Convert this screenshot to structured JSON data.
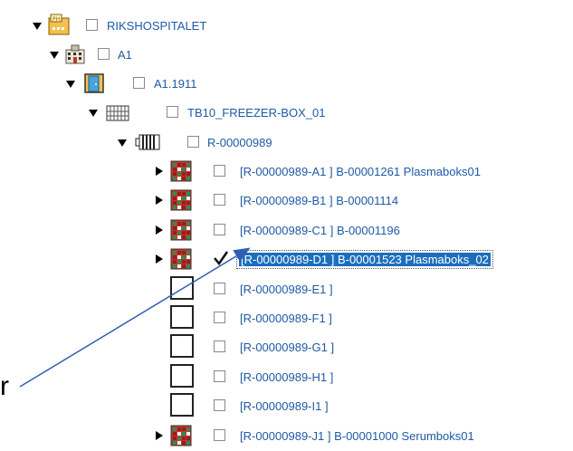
{
  "tree": {
    "hospital": {
      "label": "RIKSHOSPITALET",
      "icon": "hospital-folder-icon"
    },
    "building": {
      "label": "A1",
      "icon": "building-icon"
    },
    "room": {
      "label": "A1.1911",
      "icon": "door-icon"
    },
    "freezer": {
      "label": "TB10_FREEZER-BOX_01",
      "icon": "freezer-box-icon"
    },
    "rack": {
      "label": "R-00000989",
      "icon": "rack-icon"
    },
    "boxes": [
      {
        "label": "[R-00000989-A1 ] B-00001261 Plasmaboks01",
        "has_box": true,
        "checked": false,
        "selected": false
      },
      {
        "label": "[R-00000989-B1 ] B-00001114",
        "has_box": true,
        "checked": false,
        "selected": false
      },
      {
        "label": "[R-00000989-C1 ] B-00001196",
        "has_box": true,
        "checked": false,
        "selected": false
      },
      {
        "label": "[R-00000989-D1 ] B-00001523 Plasmaboks_02",
        "has_box": true,
        "checked": true,
        "selected": true
      },
      {
        "label": "[R-00000989-E1 ]",
        "has_box": false,
        "checked": false,
        "selected": false
      },
      {
        "label": "[R-00000989-F1 ]",
        "has_box": false,
        "checked": false,
        "selected": false
      },
      {
        "label": "[R-00000989-G1 ]",
        "has_box": false,
        "checked": false,
        "selected": false
      },
      {
        "label": "[R-00000989-H1 ]",
        "has_box": false,
        "checked": false,
        "selected": false
      },
      {
        "label": "[R-00000989-I1 ]",
        "has_box": false,
        "checked": false,
        "selected": false
      },
      {
        "label": "[R-00000989-J1 ] B-00001000 Serumboks01",
        "has_box": true,
        "checked": false,
        "selected": false
      }
    ]
  },
  "annotation": {
    "partial_text": "r",
    "arrow_color": "#2f5fb3"
  },
  "colors": {
    "link": "#1f5aa6",
    "selection": "#1c6ebd"
  }
}
